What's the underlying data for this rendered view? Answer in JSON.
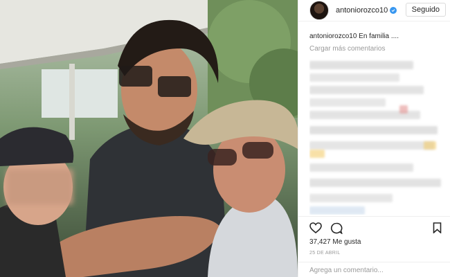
{
  "post": {
    "author": "antoniorozco10",
    "follow_label": "Seguido",
    "caption_user": "antoniorozco10",
    "caption_text": "En familia ....",
    "load_more": "Cargar más comentarios",
    "likes": "37,427 Me gusta",
    "date": "25 DE ABRIL",
    "comment_placeholder": "Agrega un comentario..."
  },
  "icons": {
    "verified": "verified-badge-icon",
    "like": "heart-icon",
    "comment": "speech-bubble-icon",
    "save": "bookmark-icon"
  },
  "colors": {
    "verified": "#3897f0",
    "text": "#262626",
    "muted": "#999999",
    "border": "#efefef"
  }
}
